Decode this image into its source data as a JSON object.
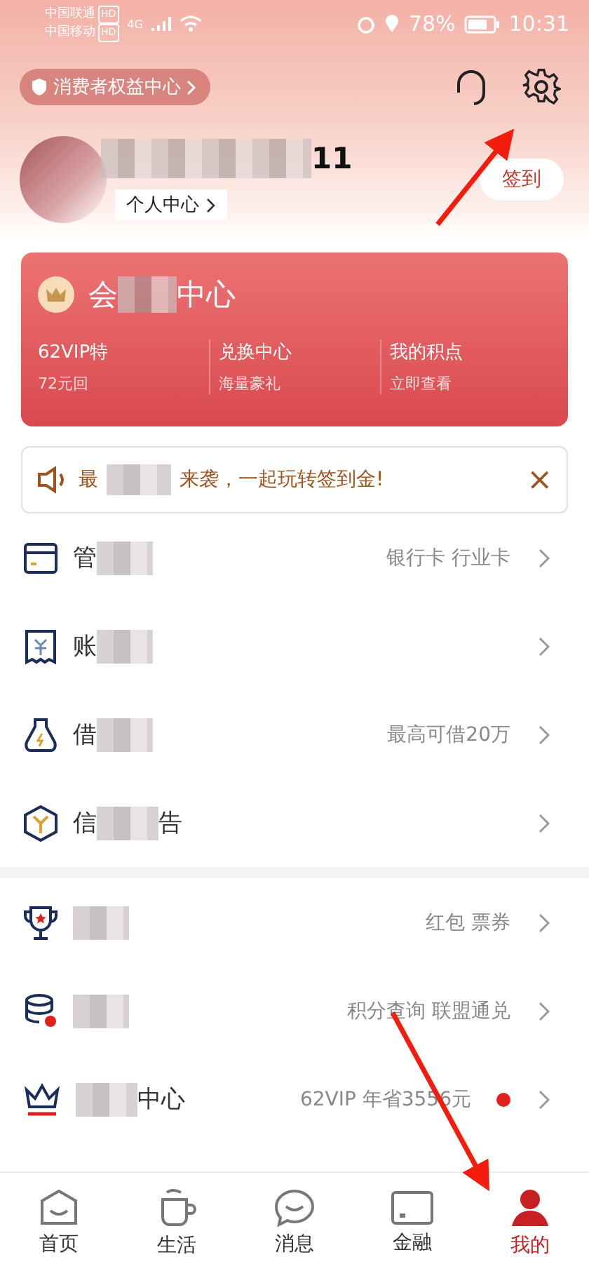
{
  "status_bar": {
    "carriers": [
      {
        "name": "中国联通",
        "badge": "HD"
      },
      {
        "name": "中国移动",
        "badge": "HD"
      }
    ],
    "network": "4G",
    "battery": "78%",
    "time": "10:31"
  },
  "header": {
    "rights_pill": "消费者权益中心",
    "user_name_end": "11",
    "profile_link": "个人中心",
    "checkin_button": "签到"
  },
  "member_card": {
    "title_start": "会",
    "title_end": "中心",
    "cells": [
      {
        "title": "62VIP特",
        "subtitle": "72元回"
      },
      {
        "title": "兑换中心",
        "subtitle": "海量豪礼"
      },
      {
        "title": "我的积点",
        "subtitle": "立即查看"
      }
    ]
  },
  "notice": {
    "text_start": "最",
    "text_end": "来袭，一起玩转签到金!",
    "close": "×"
  },
  "menu_groups": [
    [
      {
        "kind": "card",
        "title_start": "管",
        "detail": "银行卡 行业卡",
        "dot": false
      },
      {
        "kind": "receipt",
        "title_start": "账",
        "dot": false
      },
      {
        "kind": "bag",
        "title_start": "借",
        "detail": "最高可借20万",
        "dot": false
      },
      {
        "kind": "hexagon",
        "title_start": "信",
        "title_end": "告",
        "dot": false
      }
    ],
    [
      {
        "kind": "trophy",
        "detail": "红包 票券",
        "dot": false
      },
      {
        "kind": "coins",
        "detail": "积分查询 联盟通兑",
        "dot": false
      },
      {
        "kind": "crown",
        "title_end": "中心",
        "detail": "62VIP 年省3556元",
        "dot": true
      }
    ]
  ],
  "tabs": [
    {
      "label": "首页",
      "kind": "home",
      "selected": false
    },
    {
      "label": "生活",
      "kind": "cup",
      "selected": false
    },
    {
      "label": "消息",
      "kind": "chat",
      "selected": false
    },
    {
      "label": "金融",
      "kind": "card",
      "selected": false
    },
    {
      "label": "我的",
      "kind": "person",
      "selected": true
    }
  ]
}
